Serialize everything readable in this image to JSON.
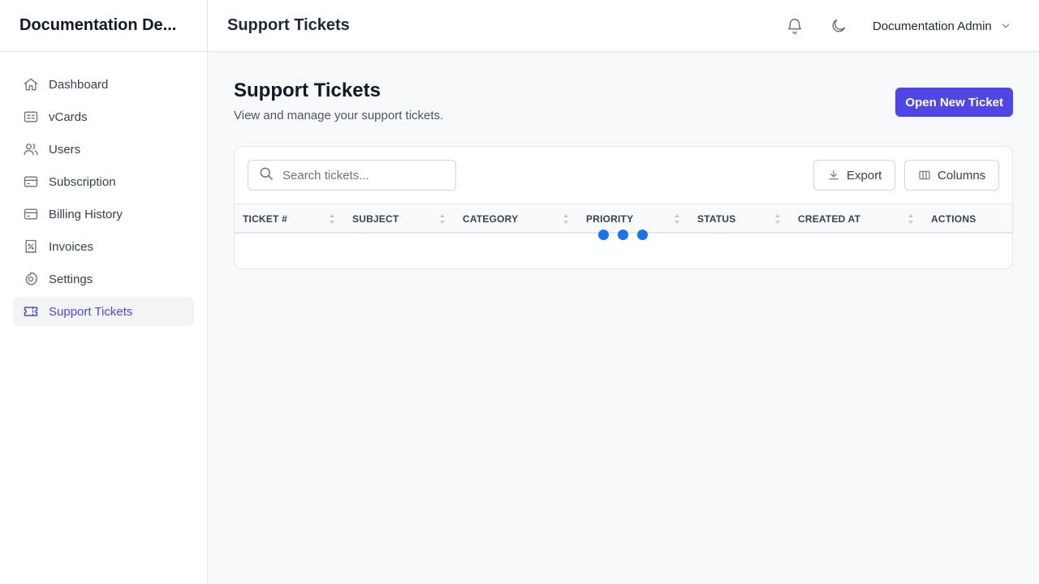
{
  "app": {
    "brand": "Documentation De..."
  },
  "sidebar": {
    "items": [
      {
        "label": "Dashboard",
        "icon": "home-icon",
        "active": false
      },
      {
        "label": "vCards",
        "icon": "id-card-icon",
        "active": false
      },
      {
        "label": "Users",
        "icon": "users-icon",
        "active": false
      },
      {
        "label": "Subscription",
        "icon": "credit-card-icon",
        "active": false
      },
      {
        "label": "Billing History",
        "icon": "credit-card-icon",
        "active": false
      },
      {
        "label": "Invoices",
        "icon": "receipt-icon",
        "active": false
      },
      {
        "label": "Settings",
        "icon": "gear-icon",
        "active": false
      },
      {
        "label": "Support Tickets",
        "icon": "ticket-icon",
        "active": true
      }
    ]
  },
  "header": {
    "title": "Support Tickets",
    "user_name": "Documentation Admin",
    "icons": [
      "bell-icon",
      "moon-icon",
      "chevron-down-icon"
    ]
  },
  "page": {
    "title": "Support Tickets",
    "subtitle": "View and manage your support tickets.",
    "primary_button": "Open New Ticket"
  },
  "table": {
    "search_placeholder": "Search tickets...",
    "export_label": "Export",
    "columns_label": "Columns",
    "headers": [
      "TICKET #",
      "SUBJECT",
      "CATEGORY",
      "PRIORITY",
      "STATUS",
      "CREATED AT",
      "ACTIONS"
    ],
    "loading": true
  },
  "colors": {
    "accent": "#4f46e5",
    "loader": "#1a73e8",
    "active_nav_bg": "#f3f4f6"
  }
}
